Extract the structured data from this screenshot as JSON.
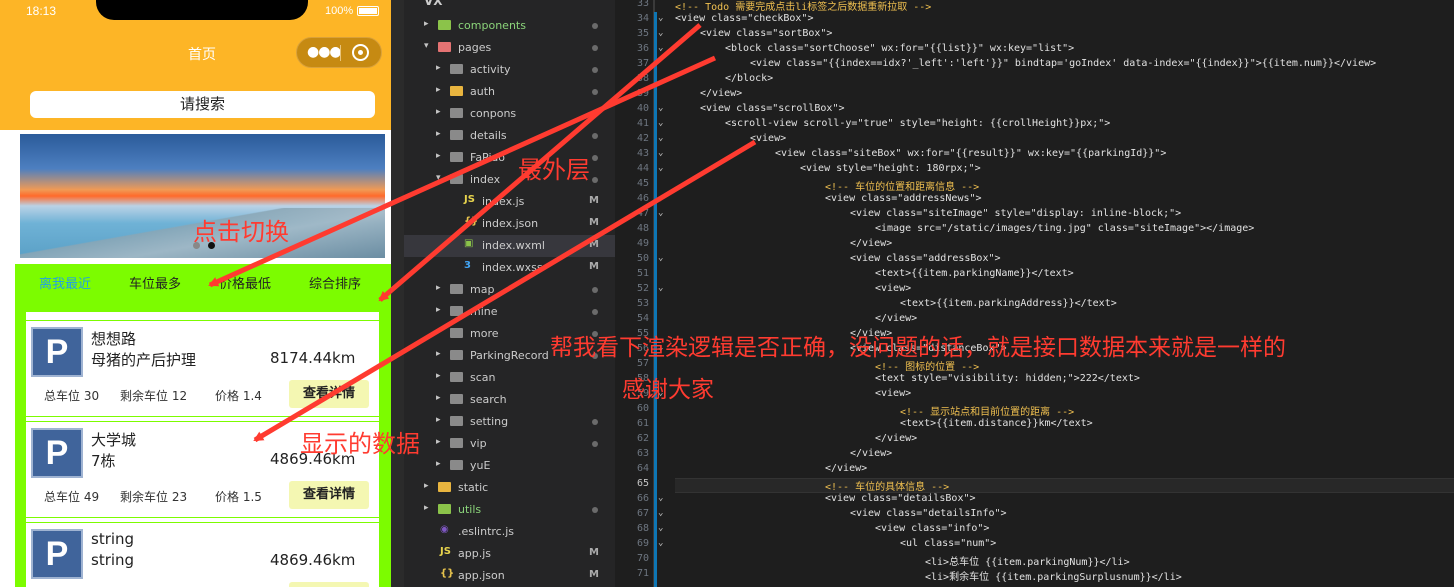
{
  "phone": {
    "status_time": "18:13",
    "battery": "100%",
    "nav_title": "首页",
    "search_placeholder": "请搜索",
    "tabs": [
      "离我最近",
      "车位最多",
      "价格最低",
      "综合排序"
    ],
    "active_tab": 0,
    "cards": [
      {
        "icon": "P",
        "name": "想想路",
        "address": "母猪的产后护理",
        "distance": "8174.44km",
        "total": "总车位 30",
        "remaining": "剩余车位 12",
        "price": "价格 1.4",
        "button": "查看详情"
      },
      {
        "icon": "P",
        "name": "大学城",
        "address": "7栋",
        "distance": "4869.46km",
        "total": "总车位 49",
        "remaining": "剩余车位 23",
        "price": "价格 1.5",
        "button": "查看详情"
      },
      {
        "icon": "P",
        "name": "string",
        "address": "string",
        "distance": "4869.46km",
        "total": "",
        "remaining": "",
        "price": "",
        "button": ""
      }
    ]
  },
  "explorer": {
    "root": "VX",
    "items": [
      {
        "label": "components",
        "kind": "folder",
        "color": "green",
        "expanded": false,
        "badge": "dot",
        "indent": 1
      },
      {
        "label": "pages",
        "kind": "folder",
        "color": "red",
        "expanded": true,
        "badge": "dot",
        "indent": 1
      },
      {
        "label": "activity",
        "kind": "folder",
        "color": "gray",
        "expanded": false,
        "badge": "dot",
        "indent": 2
      },
      {
        "label": "auth",
        "kind": "folder",
        "color": "yellow",
        "expanded": false,
        "badge": "dot",
        "indent": 2
      },
      {
        "label": "conpons",
        "kind": "folder",
        "color": "gray",
        "expanded": false,
        "badge": "dot",
        "indent": 2
      },
      {
        "label": "details",
        "kind": "folder",
        "color": "gray",
        "expanded": false,
        "badge": "dot",
        "indent": 2
      },
      {
        "label": "FaPiao",
        "kind": "folder",
        "color": "gray",
        "expanded": false,
        "badge": "dot",
        "indent": 2
      },
      {
        "label": "index",
        "kind": "folder",
        "color": "gray",
        "expanded": true,
        "badge": "dot",
        "indent": 2
      },
      {
        "label": "index.js",
        "kind": "js",
        "badge": "M",
        "indent": 3
      },
      {
        "label": "index.json",
        "kind": "json",
        "badge": "M",
        "indent": 3
      },
      {
        "label": "index.wxml",
        "kind": "wxml",
        "badge": "M",
        "indent": 3
      },
      {
        "label": "index.wxss",
        "kind": "wxss",
        "badge": "M",
        "indent": 3
      },
      {
        "label": "map",
        "kind": "folder",
        "color": "gray",
        "expanded": false,
        "badge": "dot",
        "indent": 2
      },
      {
        "label": "mine",
        "kind": "folder",
        "color": "gray",
        "expanded": false,
        "badge": "dot",
        "indent": 2
      },
      {
        "label": "more",
        "kind": "folder",
        "color": "gray",
        "expanded": false,
        "badge": "dot",
        "indent": 2
      },
      {
        "label": "ParkingRecord",
        "kind": "folder",
        "color": "gray",
        "expanded": false,
        "badge": "dot",
        "indent": 2
      },
      {
        "label": "scan",
        "kind": "folder",
        "color": "gray",
        "expanded": false,
        "badge": "",
        "indent": 2
      },
      {
        "label": "search",
        "kind": "folder",
        "color": "gray",
        "expanded": false,
        "badge": "",
        "indent": 2
      },
      {
        "label": "setting",
        "kind": "folder",
        "color": "gray",
        "expanded": false,
        "badge": "dot",
        "indent": 2
      },
      {
        "label": "vip",
        "kind": "folder",
        "color": "gray",
        "expanded": false,
        "badge": "dot",
        "indent": 2
      },
      {
        "label": "yuE",
        "kind": "folder",
        "color": "gray",
        "expanded": false,
        "badge": "",
        "indent": 2
      },
      {
        "label": "static",
        "kind": "folder",
        "color": "yellow",
        "expanded": false,
        "badge": "",
        "indent": 1
      },
      {
        "label": "utils",
        "kind": "folder",
        "color": "green",
        "expanded": false,
        "badge": "dot",
        "indent": 1
      },
      {
        "label": ".eslintrc.js",
        "kind": "eslint",
        "badge": "",
        "indent": 1
      },
      {
        "label": "app.js",
        "kind": "js",
        "badge": "M",
        "indent": 1
      },
      {
        "label": "app.json",
        "kind": "json",
        "badge": "M",
        "indent": 1
      }
    ]
  },
  "editor": {
    "current_line": 65,
    "lines": [
      {
        "n": 33,
        "fold": "",
        "indent": 0,
        "text": "<!-- Todo 需要完成点击li标签之后数据重新拉取 -->"
      },
      {
        "n": 34,
        "fold": "v",
        "indent": 0,
        "text": "<view class=\"checkBox\">"
      },
      {
        "n": 35,
        "fold": "v",
        "indent": 1,
        "text": "<view class=\"sortBox\">"
      },
      {
        "n": 36,
        "fold": "v",
        "indent": 2,
        "text": "<block class=\"sortChoose\" wx:for=\"{{list}}\" wx:key=\"list\">"
      },
      {
        "n": 37,
        "fold": "",
        "indent": 3,
        "text": "<view class=\"{{index==idx?'_left':'left'}}\" bindtap='goIndex' data-index=\"{{index}}\">{{item.num}}</view>"
      },
      {
        "n": 38,
        "fold": "",
        "indent": 2,
        "text": "</block>"
      },
      {
        "n": 39,
        "fold": "",
        "indent": 1,
        "text": "</view>"
      },
      {
        "n": 40,
        "fold": "v",
        "indent": 1,
        "text": "<view class=\"scrollBox\">"
      },
      {
        "n": 41,
        "fold": "v",
        "indent": 2,
        "text": "<scroll-view scroll-y=\"true\" style=\"height: {{crollHeight}}px;\">"
      },
      {
        "n": 42,
        "fold": "v",
        "indent": 3,
        "text": "<view>"
      },
      {
        "n": 43,
        "fold": "v",
        "indent": 4,
        "text": "<view class=\"siteBox\" wx:for=\"{{result}}\" wx:key=\"{{parkingId}}\">"
      },
      {
        "n": 44,
        "fold": "v",
        "indent": 5,
        "text": "<view style=\"height: 180rpx;\">"
      },
      {
        "n": 45,
        "fold": "",
        "indent": 6,
        "text": "<!-- 车位的位置和距离信息 -->"
      },
      {
        "n": 46,
        "fold": "v",
        "indent": 6,
        "text": "<view class=\"addressNews\">"
      },
      {
        "n": 47,
        "fold": "v",
        "indent": 7,
        "text": "<view class=\"siteImage\" style=\"display: inline-block;\">"
      },
      {
        "n": 48,
        "fold": "",
        "indent": 8,
        "text": "<image src=\"/static/images/ting.jpg\" class=\"siteImage\"></image>"
      },
      {
        "n": 49,
        "fold": "",
        "indent": 7,
        "text": "</view>"
      },
      {
        "n": 50,
        "fold": "v",
        "indent": 7,
        "text": "<view class=\"addressBox\">"
      },
      {
        "n": 51,
        "fold": "",
        "indent": 8,
        "text": "<text>{{item.parkingName}}</text>"
      },
      {
        "n": 52,
        "fold": "v",
        "indent": 8,
        "text": "<view>"
      },
      {
        "n": 53,
        "fold": "",
        "indent": 9,
        "text": "<text>{{item.parkingAddress}}</text>"
      },
      {
        "n": 54,
        "fold": "",
        "indent": 8,
        "text": "</view>"
      },
      {
        "n": 55,
        "fold": "",
        "indent": 7,
        "text": "</view>"
      },
      {
        "n": 56,
        "fold": "v",
        "indent": 7,
        "text": "<view class=\"distanceBox\">"
      },
      {
        "n": 57,
        "fold": "",
        "indent": 8,
        "text": "<!-- 图标的位置 -->"
      },
      {
        "n": 58,
        "fold": "",
        "indent": 8,
        "text": "<text style=\"visibility: hidden;\">222</text>"
      },
      {
        "n": 59,
        "fold": "v",
        "indent": 8,
        "text": "<view>"
      },
      {
        "n": 60,
        "fold": "",
        "indent": 9,
        "text": "<!-- 显示站点和目前位置的距离 -->"
      },
      {
        "n": 61,
        "fold": "",
        "indent": 9,
        "text": "<text>{{item.distance}}km</text>"
      },
      {
        "n": 62,
        "fold": "",
        "indent": 8,
        "text": "</view>"
      },
      {
        "n": 63,
        "fold": "",
        "indent": 7,
        "text": "</view>"
      },
      {
        "n": 64,
        "fold": "",
        "indent": 6,
        "text": "</view>"
      },
      {
        "n": 65,
        "fold": "",
        "indent": 6,
        "text": "<!-- 车位的具体信息 -->"
      },
      {
        "n": 66,
        "fold": "v",
        "indent": 6,
        "text": "<view class=\"detailsBox\">"
      },
      {
        "n": 67,
        "fold": "v",
        "indent": 7,
        "text": "<view class=\"detailsInfo\">"
      },
      {
        "n": 68,
        "fold": "v",
        "indent": 8,
        "text": "<view class=\"info\">"
      },
      {
        "n": 69,
        "fold": "v",
        "indent": 9,
        "text": "<ul class=\"num\">"
      },
      {
        "n": 70,
        "fold": "",
        "indent": 10,
        "text": "<li>总车位 {{item.parkingNum}}</li>"
      },
      {
        "n": 71,
        "fold": "",
        "indent": 10,
        "text": "<li>剩余车位 {{item.parkingSurplusnum}}</li>"
      }
    ]
  },
  "annotations": {
    "outer_layer": "最外层",
    "click_switch": "点击切换",
    "shown_data": "显示的数据",
    "question_line1": "帮我看下渲染逻辑是否正确，没问题的话，就是接口数据本来就是一样的",
    "question_line2": "感谢大家"
  },
  "colors": {
    "header_yellow": "#fdb526",
    "list_green": "#7cfc00",
    "active_tab_blue": "#22a0e6",
    "annotation_red": "#ff3b30",
    "editor_bg": "#1e1e1e",
    "explorer_bg": "#252526"
  }
}
